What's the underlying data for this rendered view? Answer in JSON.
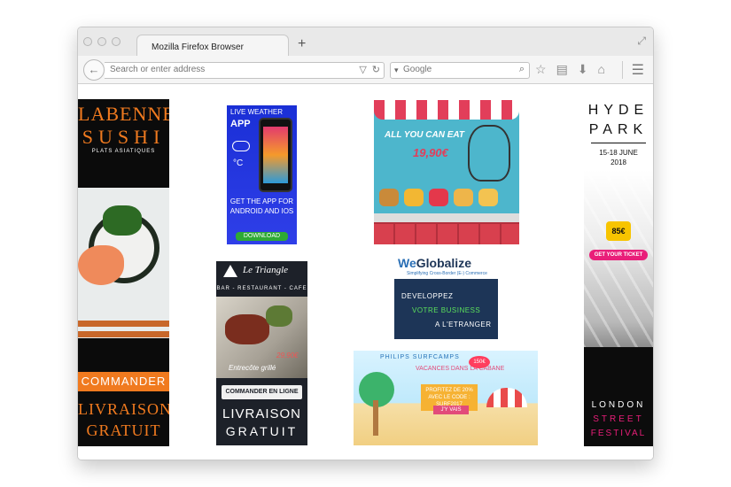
{
  "browser": {
    "tab_title": "Mozilla Firefox Browser",
    "new_tab": "+",
    "address_placeholder": "Search or enter address",
    "search_placeholder": "Google"
  },
  "ads": {
    "sushi": {
      "line1": "LABENNE",
      "line2": "SUSHI",
      "line3": "PLATS ASIATIQUES",
      "cta": "COMMANDER",
      "footer1": "LIVRAISON",
      "footer2": "GRATUIT"
    },
    "weather": {
      "header": "LIVE WEATHER",
      "app": "APP",
      "degree": "°C",
      "body": "GET THE APP FOR ANDROID AND IOS",
      "button": "DOWNLOAD"
    },
    "burger": {
      "headline": "ALL YOU CAN EAT",
      "price": "19,90€"
    },
    "hyde": {
      "title1": "HYDE",
      "title2": "PARK",
      "date1": "15-18 JUNE",
      "date2": "2018",
      "price": "85€",
      "button": "GET YOUR TICKET",
      "footer1": "LONDON",
      "footer2": "STREET",
      "footer3": "FESTIVAL"
    },
    "triangle": {
      "name": "Le Triangle",
      "subtitle": "BAR - RESTAURANT - CAFE",
      "price": "29,90€",
      "caption": "Entrecôte grillé",
      "button": "COMMANDER EN LIGNE",
      "footer1": "LIVRAISON",
      "footer2": "GRATUIT"
    },
    "weglobalize": {
      "logo_we": "We",
      "logo_rest": "Globalize",
      "tagline": "Simplifying Cross-Border (E-) Commerce",
      "line1": "DEVELOPPEZ",
      "line2": "VOTRE BUSINESS",
      "line3": "A L'ETRANGER"
    },
    "surf": {
      "brand": "PHILIPS SURFCAMPS",
      "vacation": "VACANCES DANS LA CABANE",
      "badge": "150€",
      "promo": "PROFITEZ DE 20% AVEC LE CODE : SURF2017",
      "button": "J'Y VAIS"
    }
  }
}
